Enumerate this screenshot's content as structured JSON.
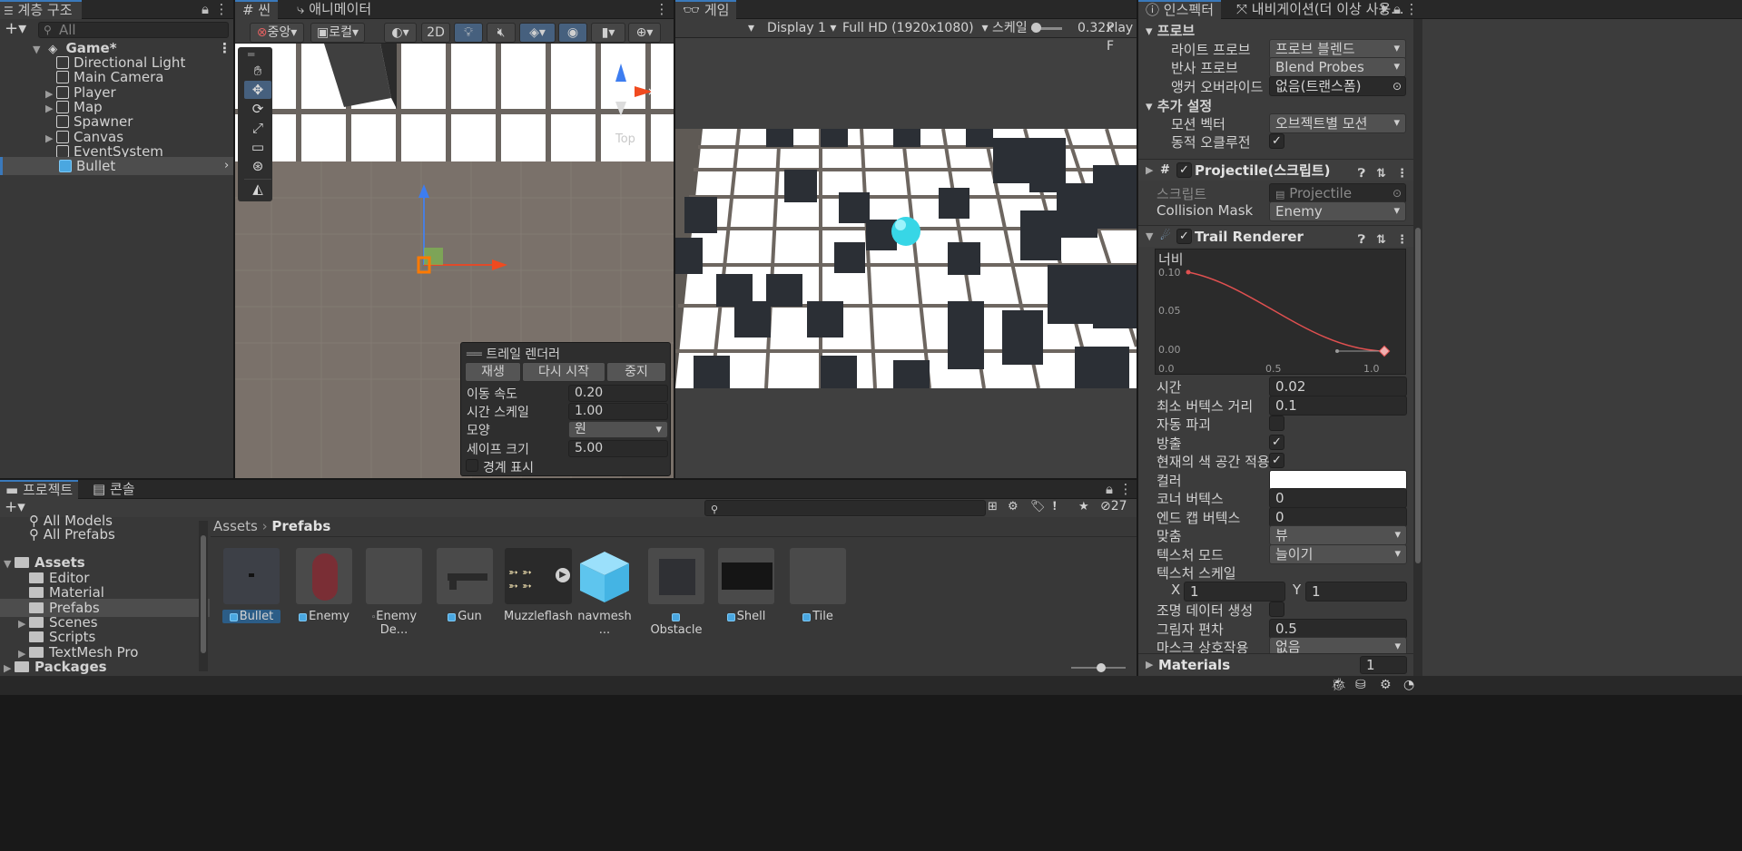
{
  "hierarchy": {
    "tab_label": "계층 구조",
    "search_placeholder": "All",
    "scene_name": "Game*",
    "items": [
      "Directional Light",
      "Main Camera",
      "Player",
      "Map",
      "Spawner",
      "Canvas",
      "EventSystem",
      "Bullet"
    ]
  },
  "scene": {
    "tabs": [
      "씬",
      "애니메이터"
    ],
    "pivot_label": "중앙",
    "space_label": "로컬",
    "mode_2d": "2D",
    "gizmo_label": "Top",
    "overlay": {
      "title": "트레일 렌더러",
      "buttons": [
        "재생",
        "다시 시작",
        "중지"
      ],
      "rows": [
        {
          "label": "이동 속도",
          "value": "0.20"
        },
        {
          "label": "시간 스케일",
          "value": "1.00"
        },
        {
          "label": "모양",
          "value": "원"
        },
        {
          "label": "세이프 크기",
          "value": "5.00"
        }
      ],
      "checkbox_label": "경계 표시"
    }
  },
  "game": {
    "tab_label": "게임",
    "display": "Display 1",
    "resolution": "Full HD (1920x1080)",
    "scale_label": "스케일",
    "scale_value": "0.32x",
    "play_label": "Play F"
  },
  "inspector": {
    "tabs": [
      "인스펙터",
      "내비게이션(더 이상 사용..."
    ],
    "probes_header": "프로브",
    "light_probe_label": "라이트 프로브",
    "light_probe_value": "프로브 블렌드",
    "reflection_label": "반사 프로브",
    "reflection_value": "Blend Probes",
    "anchor_label": "앵커 오버라이드",
    "anchor_value": "없음(트랜스폼)",
    "extra_header": "추가 설정",
    "motion_label": "모션 벡터",
    "motion_value": "오브젝트별 모션",
    "occlusion_label": "동적 오클루전",
    "projectile_title": "Projectile(스크립트)",
    "script_label": "스크립트",
    "script_value": "Projectile",
    "mask_label": "Collision Mask",
    "mask_value": "Enemy",
    "trail_title": "Trail Renderer",
    "width_label": "너비",
    "curve_y": [
      "0.10",
      "0.05",
      "0.00"
    ],
    "curve_x": [
      "0.0",
      "0.5",
      "1.0"
    ],
    "fields": [
      {
        "label": "시간",
        "value": "0.02",
        "kind": "text"
      },
      {
        "label": "최소 버텍스 거리",
        "value": "0.1",
        "kind": "text"
      },
      {
        "label": "자동 파괴",
        "value": "",
        "kind": "check"
      },
      {
        "label": "방출",
        "value": "✓",
        "kind": "check"
      },
      {
        "label": "현재의 색 공간 적용",
        "value": "✓",
        "kind": "check"
      },
      {
        "label": "컬러",
        "value": "",
        "kind": "color"
      },
      {
        "label": "코너 버텍스",
        "value": "0",
        "kind": "text"
      },
      {
        "label": "엔드 캡 버텍스",
        "value": "0",
        "kind": "text"
      },
      {
        "label": "맞춤",
        "value": "뷰",
        "kind": "dd"
      },
      {
        "label": "텍스처 모드",
        "value": "늘이기",
        "kind": "dd"
      },
      {
        "label": "텍스처 스케일",
        "value": "",
        "kind": "none"
      }
    ],
    "scale_x_label": "X",
    "scale_x": "1",
    "scale_y_label": "Y",
    "scale_y": "1",
    "fields2": [
      {
        "label": "조명 데이터 생성",
        "value": "",
        "kind": "check"
      },
      {
        "label": "그림자 편차",
        "value": "0.5",
        "kind": "text"
      },
      {
        "label": "마스크 상호작용",
        "value": "없음",
        "kind": "dd"
      }
    ],
    "materials_label": "Materials",
    "materials_count": "1"
  },
  "project": {
    "tabs": [
      "프로젝트",
      "콘솔"
    ],
    "count": "27",
    "tree_top": [
      "All Models",
      "All Prefabs"
    ],
    "assets_label": "Assets",
    "folders": [
      "Editor",
      "Material",
      "Prefabs",
      "Scenes",
      "Scripts",
      "TextMesh Pro"
    ],
    "packages_label": "Packages",
    "breadcrumb_root": "Assets",
    "breadcrumb_current": "Prefabs",
    "assets": [
      "Bullet",
      "Enemy",
      "Enemy De...",
      "Gun",
      "Muzzleflash",
      "navmesh ...",
      "Obstacle",
      "Shell",
      "Tile"
    ]
  },
  "colors": {
    "accent": "#3a79bb",
    "selection": "#2c5d87",
    "bullet": "#37d6e6",
    "curve": "#e05050"
  }
}
